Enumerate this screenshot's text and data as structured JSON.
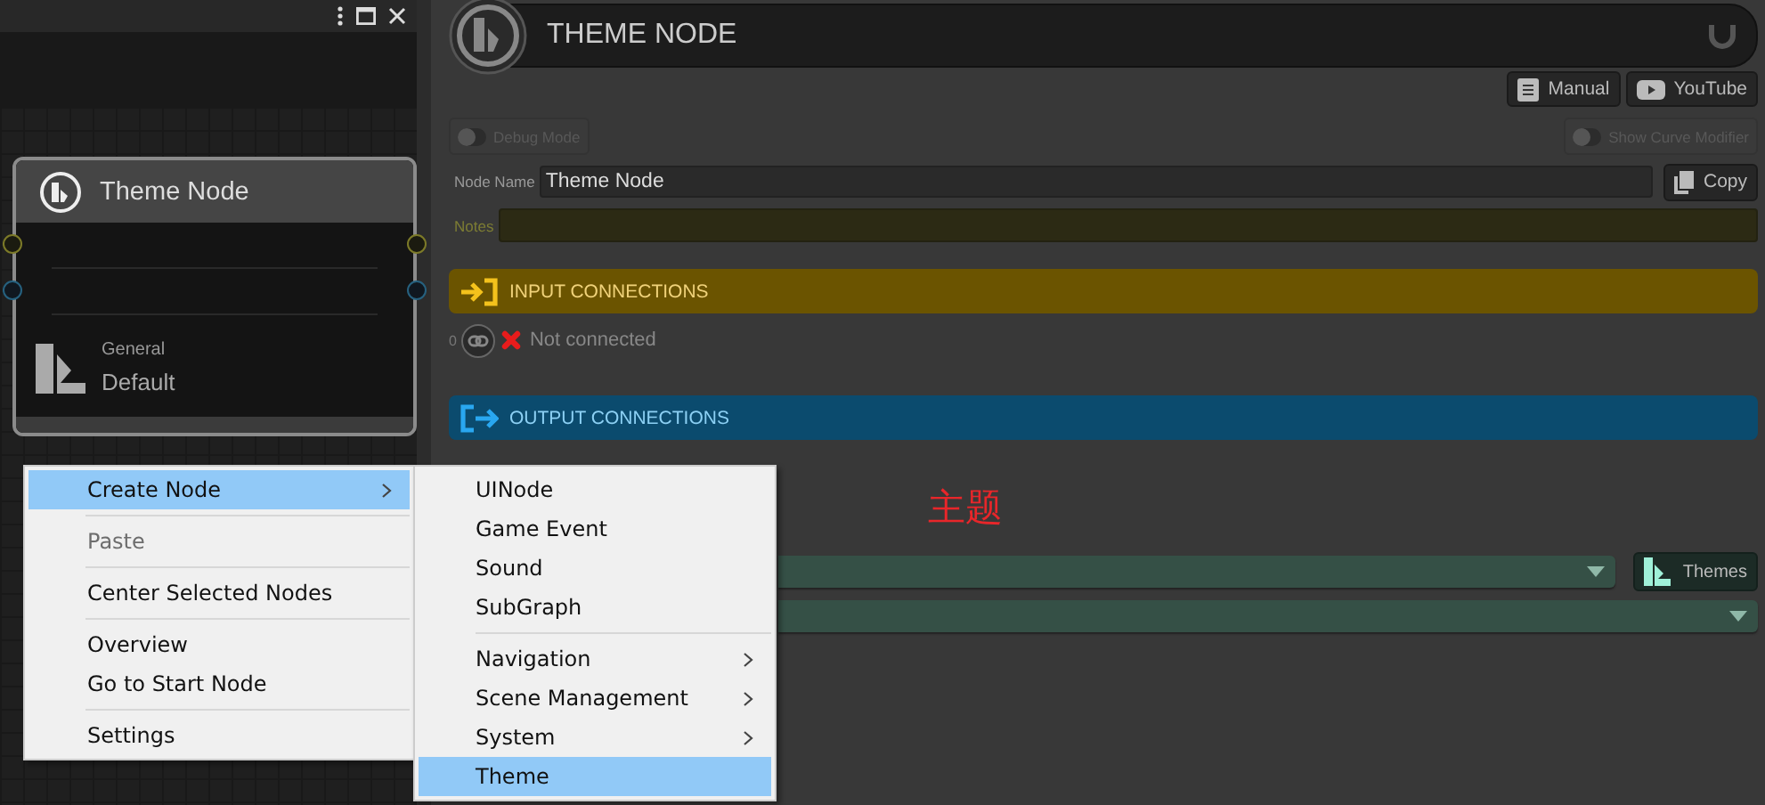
{
  "node_card": {
    "title": "Theme Node",
    "category": "General",
    "value": "Default"
  },
  "inspector": {
    "title": "THEME NODE",
    "buttons": [
      {
        "kind": "manual",
        "label": "Manual"
      },
      {
        "kind": "youtube",
        "label": "YouTube"
      }
    ],
    "toggles": [
      {
        "label": "Debug Mode",
        "on": false
      },
      {
        "label": "Show Curve Modifier",
        "on": false
      }
    ],
    "node_name": {
      "label": "Node Name",
      "value": "Theme Node"
    },
    "copy_button": "Copy",
    "notes": {
      "label": "Notes"
    },
    "sections": [
      {
        "kind": "input",
        "title": "INPUT CONNECTIONS",
        "index": "0",
        "status": "Not connected"
      },
      {
        "kind": "output",
        "title": "OUTPUT CONNECTIONS"
      }
    ],
    "annotation": "主题",
    "themes_button": "Themes"
  },
  "context_menu": {
    "groups": [
      [
        {
          "label": "Create Node",
          "selected": true,
          "disabled": false,
          "submenu": true
        }
      ],
      [
        {
          "label": "Paste",
          "selected": false,
          "disabled": true,
          "submenu": false
        }
      ],
      [
        {
          "label": "Center Selected Nodes",
          "selected": false,
          "disabled": false,
          "submenu": false
        }
      ],
      [
        {
          "label": "Overview",
          "selected": false,
          "disabled": false,
          "submenu": false
        },
        {
          "label": "Go to Start Node",
          "selected": false,
          "disabled": false,
          "submenu": false
        }
      ],
      [
        {
          "label": "Settings",
          "selected": false,
          "disabled": false,
          "submenu": false
        }
      ]
    ],
    "submenu_groups": [
      [
        {
          "label": "UINode",
          "selected": false,
          "submenu": false
        },
        {
          "label": "Game Event",
          "selected": false,
          "submenu": false
        },
        {
          "label": "Sound",
          "selected": false,
          "submenu": false
        },
        {
          "label": "SubGraph",
          "selected": false,
          "submenu": false
        }
      ],
      [
        {
          "label": "Navigation",
          "selected": false,
          "submenu": true
        },
        {
          "label": "Scene Management",
          "selected": false,
          "submenu": true
        },
        {
          "label": "System",
          "selected": false,
          "submenu": true
        },
        {
          "label": "Theme",
          "selected": true,
          "submenu": false
        }
      ]
    ]
  }
}
